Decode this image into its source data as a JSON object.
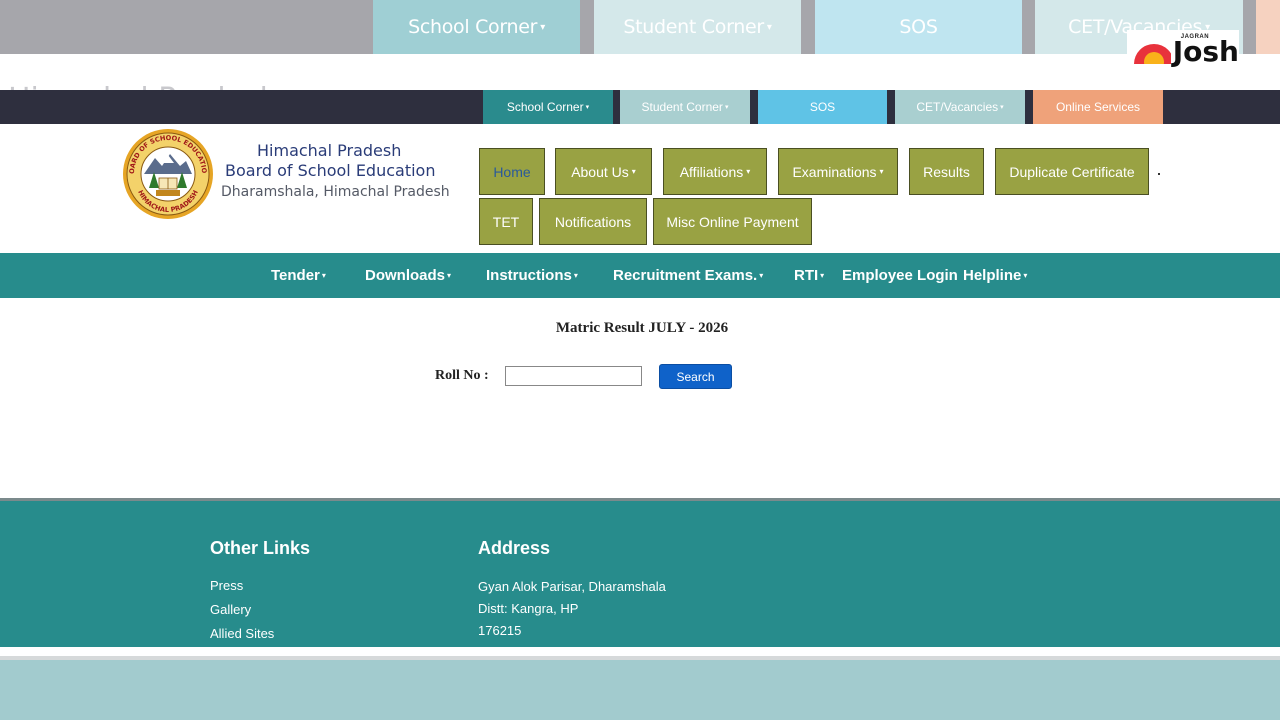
{
  "background_zoom": {
    "tabs": [
      {
        "label": "School Corner",
        "caret": "▾"
      },
      {
        "label": "Student Corner",
        "caret": "▾"
      },
      {
        "label": "SOS",
        "caret": ""
      },
      {
        "label": "CET/Vacancies",
        "caret": "▾"
      }
    ],
    "ghost_title": "Himachal Pradesh"
  },
  "watermark": {
    "small": "JAGRAN",
    "big": "Josh"
  },
  "util_bar": {
    "tabs": [
      {
        "label": "School Corner",
        "caret": "▾",
        "color": "#2a8b8d"
      },
      {
        "label": "Student Corner",
        "caret": "▾",
        "color": "#a9cfd0"
      },
      {
        "label": "SOS",
        "caret": "",
        "color": "#5fc3e6"
      },
      {
        "label": "CET/Vacancies",
        "caret": "▾",
        "color": "#a9cfd0"
      },
      {
        "label": "Online Services",
        "caret": "",
        "color": "#efa27a"
      }
    ]
  },
  "brand": {
    "line1": "Himachal Pradesh",
    "line2": "Board of School Education",
    "line3": "Dharamshala, Himachal Pradesh",
    "seal_top": "BOARD OF SCHOOL EDUCATION",
    "seal_bottom": "HIMACHAL PRADESH"
  },
  "main_nav": {
    "row1": [
      {
        "label": "Home",
        "caret": ""
      },
      {
        "label": "About Us",
        "caret": "▾"
      },
      {
        "label": "Affiliations",
        "caret": "▾"
      },
      {
        "label": "Examinations",
        "caret": "▾"
      },
      {
        "label": "Results",
        "caret": ""
      },
      {
        "label": "Duplicate Certificate",
        "caret": ""
      }
    ],
    "row2": [
      {
        "label": "TET",
        "caret": ""
      },
      {
        "label": "Notifications",
        "caret": ""
      },
      {
        "label": "Misc Online Payment",
        "caret": ""
      }
    ]
  },
  "secondary_nav": [
    {
      "label": "Tender",
      "caret": "▾"
    },
    {
      "label": "Downloads",
      "caret": "▾"
    },
    {
      "label": "Instructions",
      "caret": "▾"
    },
    {
      "label": "Recruitment Exams.",
      "caret": "▾"
    },
    {
      "label": "RTI",
      "caret": "▾"
    },
    {
      "label": "Employee Login",
      "caret": ""
    },
    {
      "label": "Helpline",
      "caret": "▾"
    }
  ],
  "result_form": {
    "title": "Matric Result JULY - 2026",
    "roll_label": "Roll No :",
    "roll_value": "",
    "search_label": "Search"
  },
  "footer": {
    "other_links_heading": "Other Links",
    "links": [
      "Press",
      "Gallery",
      "Allied Sites"
    ],
    "address_heading": "Address",
    "address_lines": [
      "Gyan Alok Parisar, Dharamshala",
      "Distt: Kangra, HP",
      "176215"
    ]
  },
  "colors": {
    "teal": "#278c8c",
    "olive_button": "#99a243",
    "search_button": "#0f62c9",
    "util_bar": "#2e2f3e"
  }
}
